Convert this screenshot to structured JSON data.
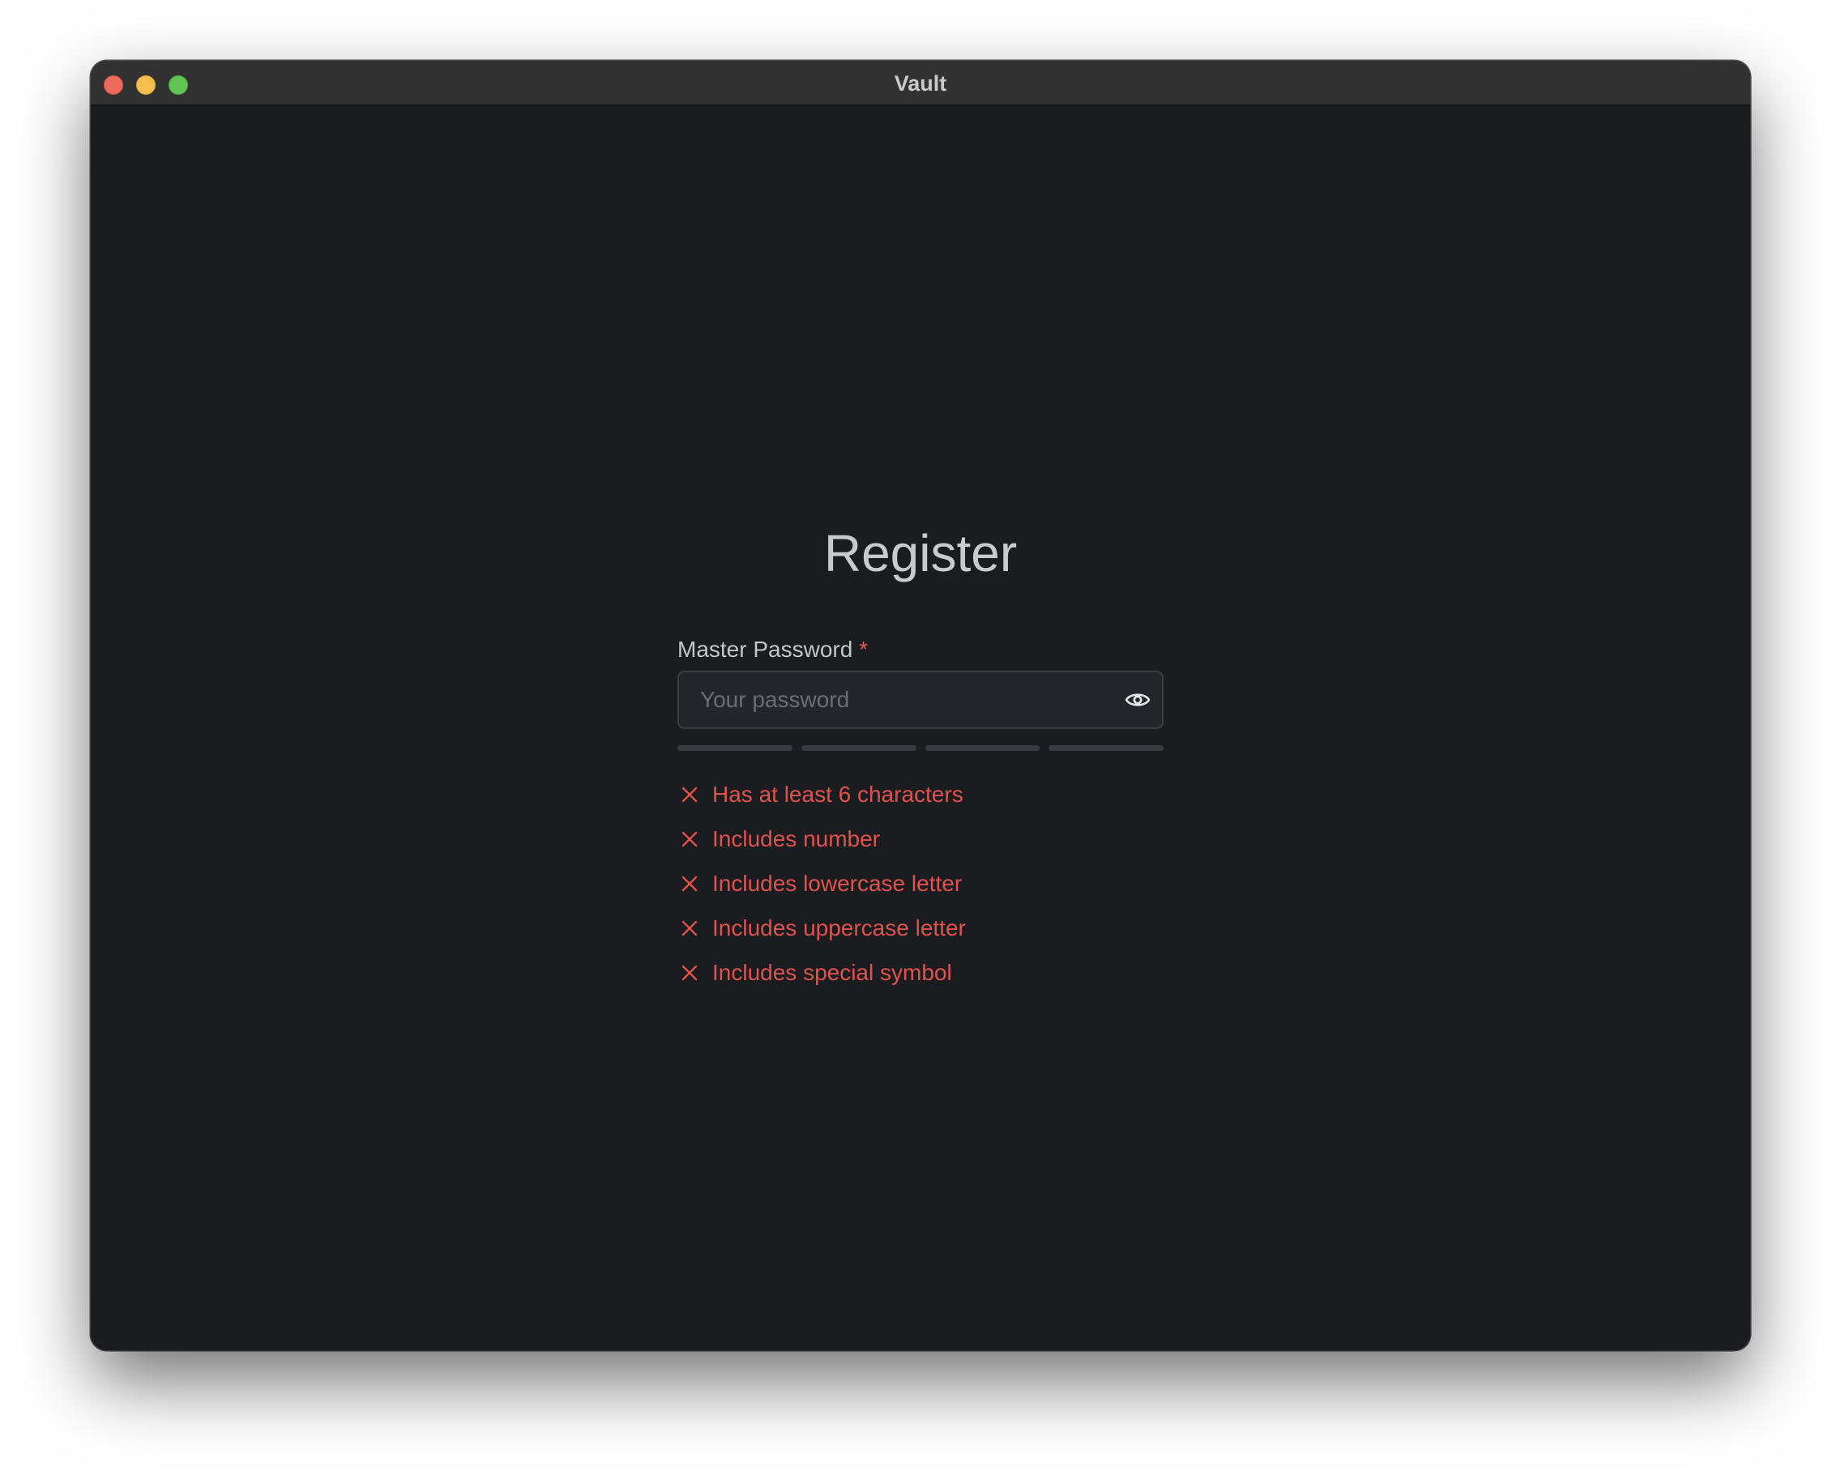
{
  "window": {
    "title": "Vault"
  },
  "page": {
    "heading": "Register"
  },
  "form": {
    "password_label": "Master Password",
    "required_marker": "*",
    "password_placeholder": "Your password",
    "password_value": "",
    "strength_segments_filled": 0,
    "strength_segments_total": 4
  },
  "requirements": [
    {
      "label": "Has at least 6 characters",
      "met": false
    },
    {
      "label": "Includes number",
      "met": false
    },
    {
      "label": "Includes lowercase letter",
      "met": false
    },
    {
      "label": "Includes uppercase letter",
      "met": false
    },
    {
      "label": "Includes special symbol",
      "met": false
    }
  ],
  "icons": {
    "toggle_visibility": "eye-icon",
    "requirement_status": "x-icon"
  },
  "colors": {
    "background": "#1b1c20",
    "titlebar": "#323232",
    "error": "#e0524d",
    "input_background": "#25262b",
    "strength_empty": "#3a3b40"
  }
}
